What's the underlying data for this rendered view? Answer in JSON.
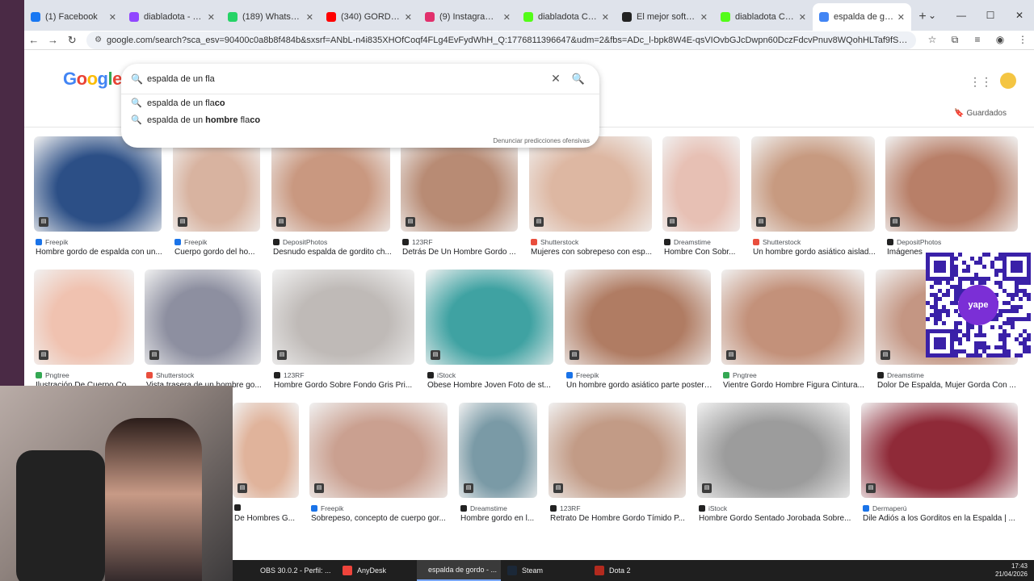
{
  "browser": {
    "tabs": [
      {
        "label": "(1) Facebook",
        "color": "#1877f2",
        "icon": "facebook-icon"
      },
      {
        "label": "diabladota - Twitch",
        "color": "#9146ff",
        "icon": "twitch-icon"
      },
      {
        "label": "(189) WhatsApp",
        "color": "#25d366",
        "icon": "whatsapp-icon"
      },
      {
        "label": "(340) GORDO x M",
        "color": "#ff0000",
        "icon": "youtube-icon"
      },
      {
        "label": "(9) Instagram • Mens",
        "color": "#e1306c",
        "icon": "instagram-icon"
      },
      {
        "label": "diabladota Clips - W",
        "color": "#53fc18",
        "icon": "kick-icon"
      },
      {
        "label": "El mejor software pa",
        "color": "#222222",
        "icon": "software-icon"
      },
      {
        "label": "diabladota Clips - W",
        "color": "#53fc18",
        "icon": "kick-icon"
      },
      {
        "label": "espalda de gordo - B",
        "color": "#4285f4",
        "icon": "google-icon",
        "active": true
      }
    ],
    "url": "google.com/search?sca_esv=90400c0a8b8f484b&sxsrf=ANbL-n4i835XHOfCoqf4FLg4EvFydWhH_Q:1776811396647&udm=2&fbs=ADc_l-bpk8W4E-qsVIOvbGJcDwpn60DczFdcvPnuv8WQohHLTaf9fS4tU71bi2aHS-Pmeg3gf3Rx3g7wPLd9q8S5Eu..."
  },
  "google": {
    "logo": {
      "l1": "G",
      "l2": "o",
      "l3": "o",
      "l4": "g",
      "l5": "l",
      "l6": "e"
    },
    "search_value": "espalda de un fla",
    "suggestions": [
      {
        "prefix": "espalda de un fla",
        "bold": "co"
      },
      {
        "prefix": "espalda de un ",
        "bold": "hombre",
        "mid": " fla",
        "bold2": "co"
      }
    ],
    "report": "Denunciar predicciones ofensivas",
    "saved": "Guardados"
  },
  "results": [
    {
      "source": "Freepik",
      "title": "Hombre gordo de espalda con un...",
      "color": "#2c4f86",
      "src_color": "#1a73e8"
    },
    {
      "source": "Freepik",
      "title": "Cuerpo gordo del ho...",
      "color": "#d8b3a0",
      "src_color": "#1a73e8"
    },
    {
      "source": "DepositPhotos",
      "title": "Desnudo espalda de gordito ch...",
      "color": "#c99880",
      "src_color": "#222222"
    },
    {
      "source": "123RF",
      "title": "Detrás De Un Hombre Gordo ...",
      "color": "#b88b74",
      "src_color": "#222222"
    },
    {
      "source": "Shutterstock",
      "title": "Mujeres con sobrepeso con esp...",
      "color": "#ddb7a2",
      "src_color": "#e94e3d"
    },
    {
      "source": "Dreamstime",
      "title": "Hombre Con Sobr...",
      "color": "#e7c0b4",
      "src_color": "#222222"
    },
    {
      "source": "Shutterstock",
      "title": "Un hombre gordo asiático aislad...",
      "color": "#c79a80",
      "src_color": "#e94e3d"
    },
    {
      "source": "DepositPhotos",
      "title": "Imágenes",
      "color": "#b87f68",
      "src_color": "#222222"
    },
    {
      "source": "Pngtree",
      "title": "Ilustración De Cuerpo Co...",
      "color": "#f0c2b0",
      "src_color": "#34a853"
    },
    {
      "source": "Shutterstock",
      "title": "Vista trasera de un hombre go...",
      "color": "#8d8fa0",
      "src_color": "#e94e3d"
    },
    {
      "source": "123RF",
      "title": "Hombre Gordo Sobre Fondo Gris Pri...",
      "color": "#bfbab7",
      "src_color": "#222222"
    },
    {
      "source": "iStock",
      "title": "Obese Hombre Joven Foto de st...",
      "color": "#3fa2a2",
      "src_color": "#222222"
    },
    {
      "source": "Freepik",
      "title": "Un hombre gordo asiático parte posteri...",
      "color": "#b07c63",
      "src_color": "#1a73e8"
    },
    {
      "source": "Pngtree",
      "title": "Vientre Gordo Hombre Figura Cintura...",
      "color": "#c3917a",
      "src_color": "#34a853"
    },
    {
      "source": "Dreamstime",
      "title": "Dolor De Espalda, Mujer Gorda Con ...",
      "color": "#c49683",
      "src_color": "#222222"
    },
    {
      "source": "",
      "title": "De Hombres G...",
      "color": "#e0b39b",
      "src_color": "#222222"
    },
    {
      "source": "Freepik",
      "title": "Sobrepeso, concepto de cuerpo gor...",
      "color": "#caa090",
      "src_color": "#1a73e8"
    },
    {
      "source": "Dreamstime",
      "title": "Hombre gordo en l...",
      "color": "#7a9aa6",
      "src_color": "#222222"
    },
    {
      "source": "123RF",
      "title": "Retrato De Hombre Gordo Tímido P...",
      "color": "#c29b86",
      "src_color": "#222222"
    },
    {
      "source": "iStock",
      "title": "Hombre Gordo Sentado Jorobada Sobre...",
      "color": "#9c9c9c",
      "src_color": "#222222"
    },
    {
      "source": "Dermaperú",
      "title": "Dile Adiós a los Gorditos en la Espalda | ...",
      "color": "#8f2a38",
      "src_color": "#1a73e8"
    }
  ],
  "overlay": {
    "qr_label": "yape"
  },
  "taskbar": {
    "items": [
      {
        "label": "OBS 30.0.2 - Perfil: ...",
        "color": "#444444",
        "icon": "obs-icon"
      },
      {
        "label": "AnyDesk",
        "color": "#ef443b",
        "icon": "anydesk-icon"
      },
      {
        "label": "espalda de gordo - ...",
        "color": "#4285f4",
        "icon": "chrome-icon",
        "active": true
      },
      {
        "label": "Steam",
        "color": "#1b2838",
        "icon": "steam-icon"
      },
      {
        "label": "Dota 2",
        "color": "#b32a1e",
        "icon": "dota-icon"
      }
    ],
    "time": "17:43",
    "date": "21/04/2026"
  }
}
